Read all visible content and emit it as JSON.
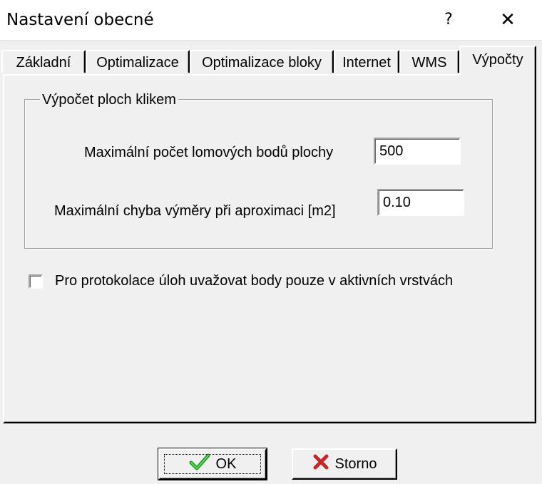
{
  "window": {
    "title": "Nastavení obecné",
    "help_label": "?",
    "close_label": "✕"
  },
  "tabs": [
    {
      "label": "Základní",
      "active": false
    },
    {
      "label": "Optimalizace",
      "active": false
    },
    {
      "label": "Optimalizace bloky",
      "active": false
    },
    {
      "label": "Internet",
      "active": false
    },
    {
      "label": "WMS",
      "active": false
    },
    {
      "label": "Výpočty",
      "active": true
    }
  ],
  "group": {
    "legend": "Výpočet ploch klikem",
    "fields": [
      {
        "label": "Maximální počet lomových bodů plochy",
        "value": "500"
      },
      {
        "label": "Maximální chyba výměry při aproximaci  [m2]",
        "value": "0.10"
      }
    ]
  },
  "checkbox": {
    "label": "Pro protokolace úloh uvažovat body pouze v aktivních vrstvách",
    "checked": false
  },
  "buttons": {
    "ok_label": "OK",
    "cancel_label": "Storno"
  },
  "colors": {
    "ok_check": "#1a9a1a",
    "cancel_x": "#c62828",
    "face": "#f0f0f0"
  }
}
